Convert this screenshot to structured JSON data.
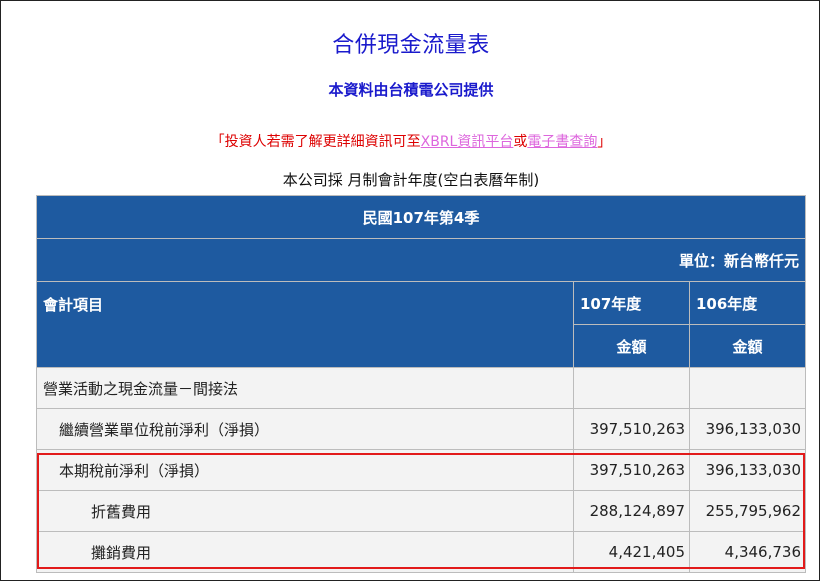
{
  "header": {
    "title": "合併現金流量表",
    "subtitle": "本資料由台積電公司提供",
    "notice_prefix": "「投資人若需了解更詳細資訊可至",
    "notice_link1": "XBRL資訊平台",
    "notice_middle": "或",
    "notice_link2": "電子書查詢",
    "notice_suffix": "」",
    "fiscal_note": "本公司採 月制會計年度(空白表曆年制)"
  },
  "table": {
    "period": "民國107年第4季",
    "unit": "單位：新台幣仟元",
    "item_header": "會計項目",
    "year_headers": [
      "107年度",
      "106年度"
    ],
    "amount_label": "金額",
    "rows": [
      {
        "label": "營業活動之現金流量－間接法",
        "v107": "",
        "v106": "",
        "indent": 0
      },
      {
        "label": "繼續營業單位稅前淨利（淨損）",
        "v107": "397,510,263",
        "v106": "396,133,030",
        "indent": 1
      },
      {
        "label": "本期稅前淨利（淨損）",
        "v107": "397,510,263",
        "v106": "396,133,030",
        "indent": 1
      },
      {
        "label": "折舊費用",
        "v107": "288,124,897",
        "v106": "255,795,962",
        "indent": 2
      },
      {
        "label": "攤銷費用",
        "v107": "4,421,405",
        "v106": "4,346,736",
        "indent": 2
      }
    ]
  },
  "colors": {
    "header_bg": "#1e5aa0",
    "title_blue": "#1a1acc",
    "notice_red": "#dd0000",
    "link_pink": "#dd66dd",
    "highlight_red": "#e21a1a"
  }
}
